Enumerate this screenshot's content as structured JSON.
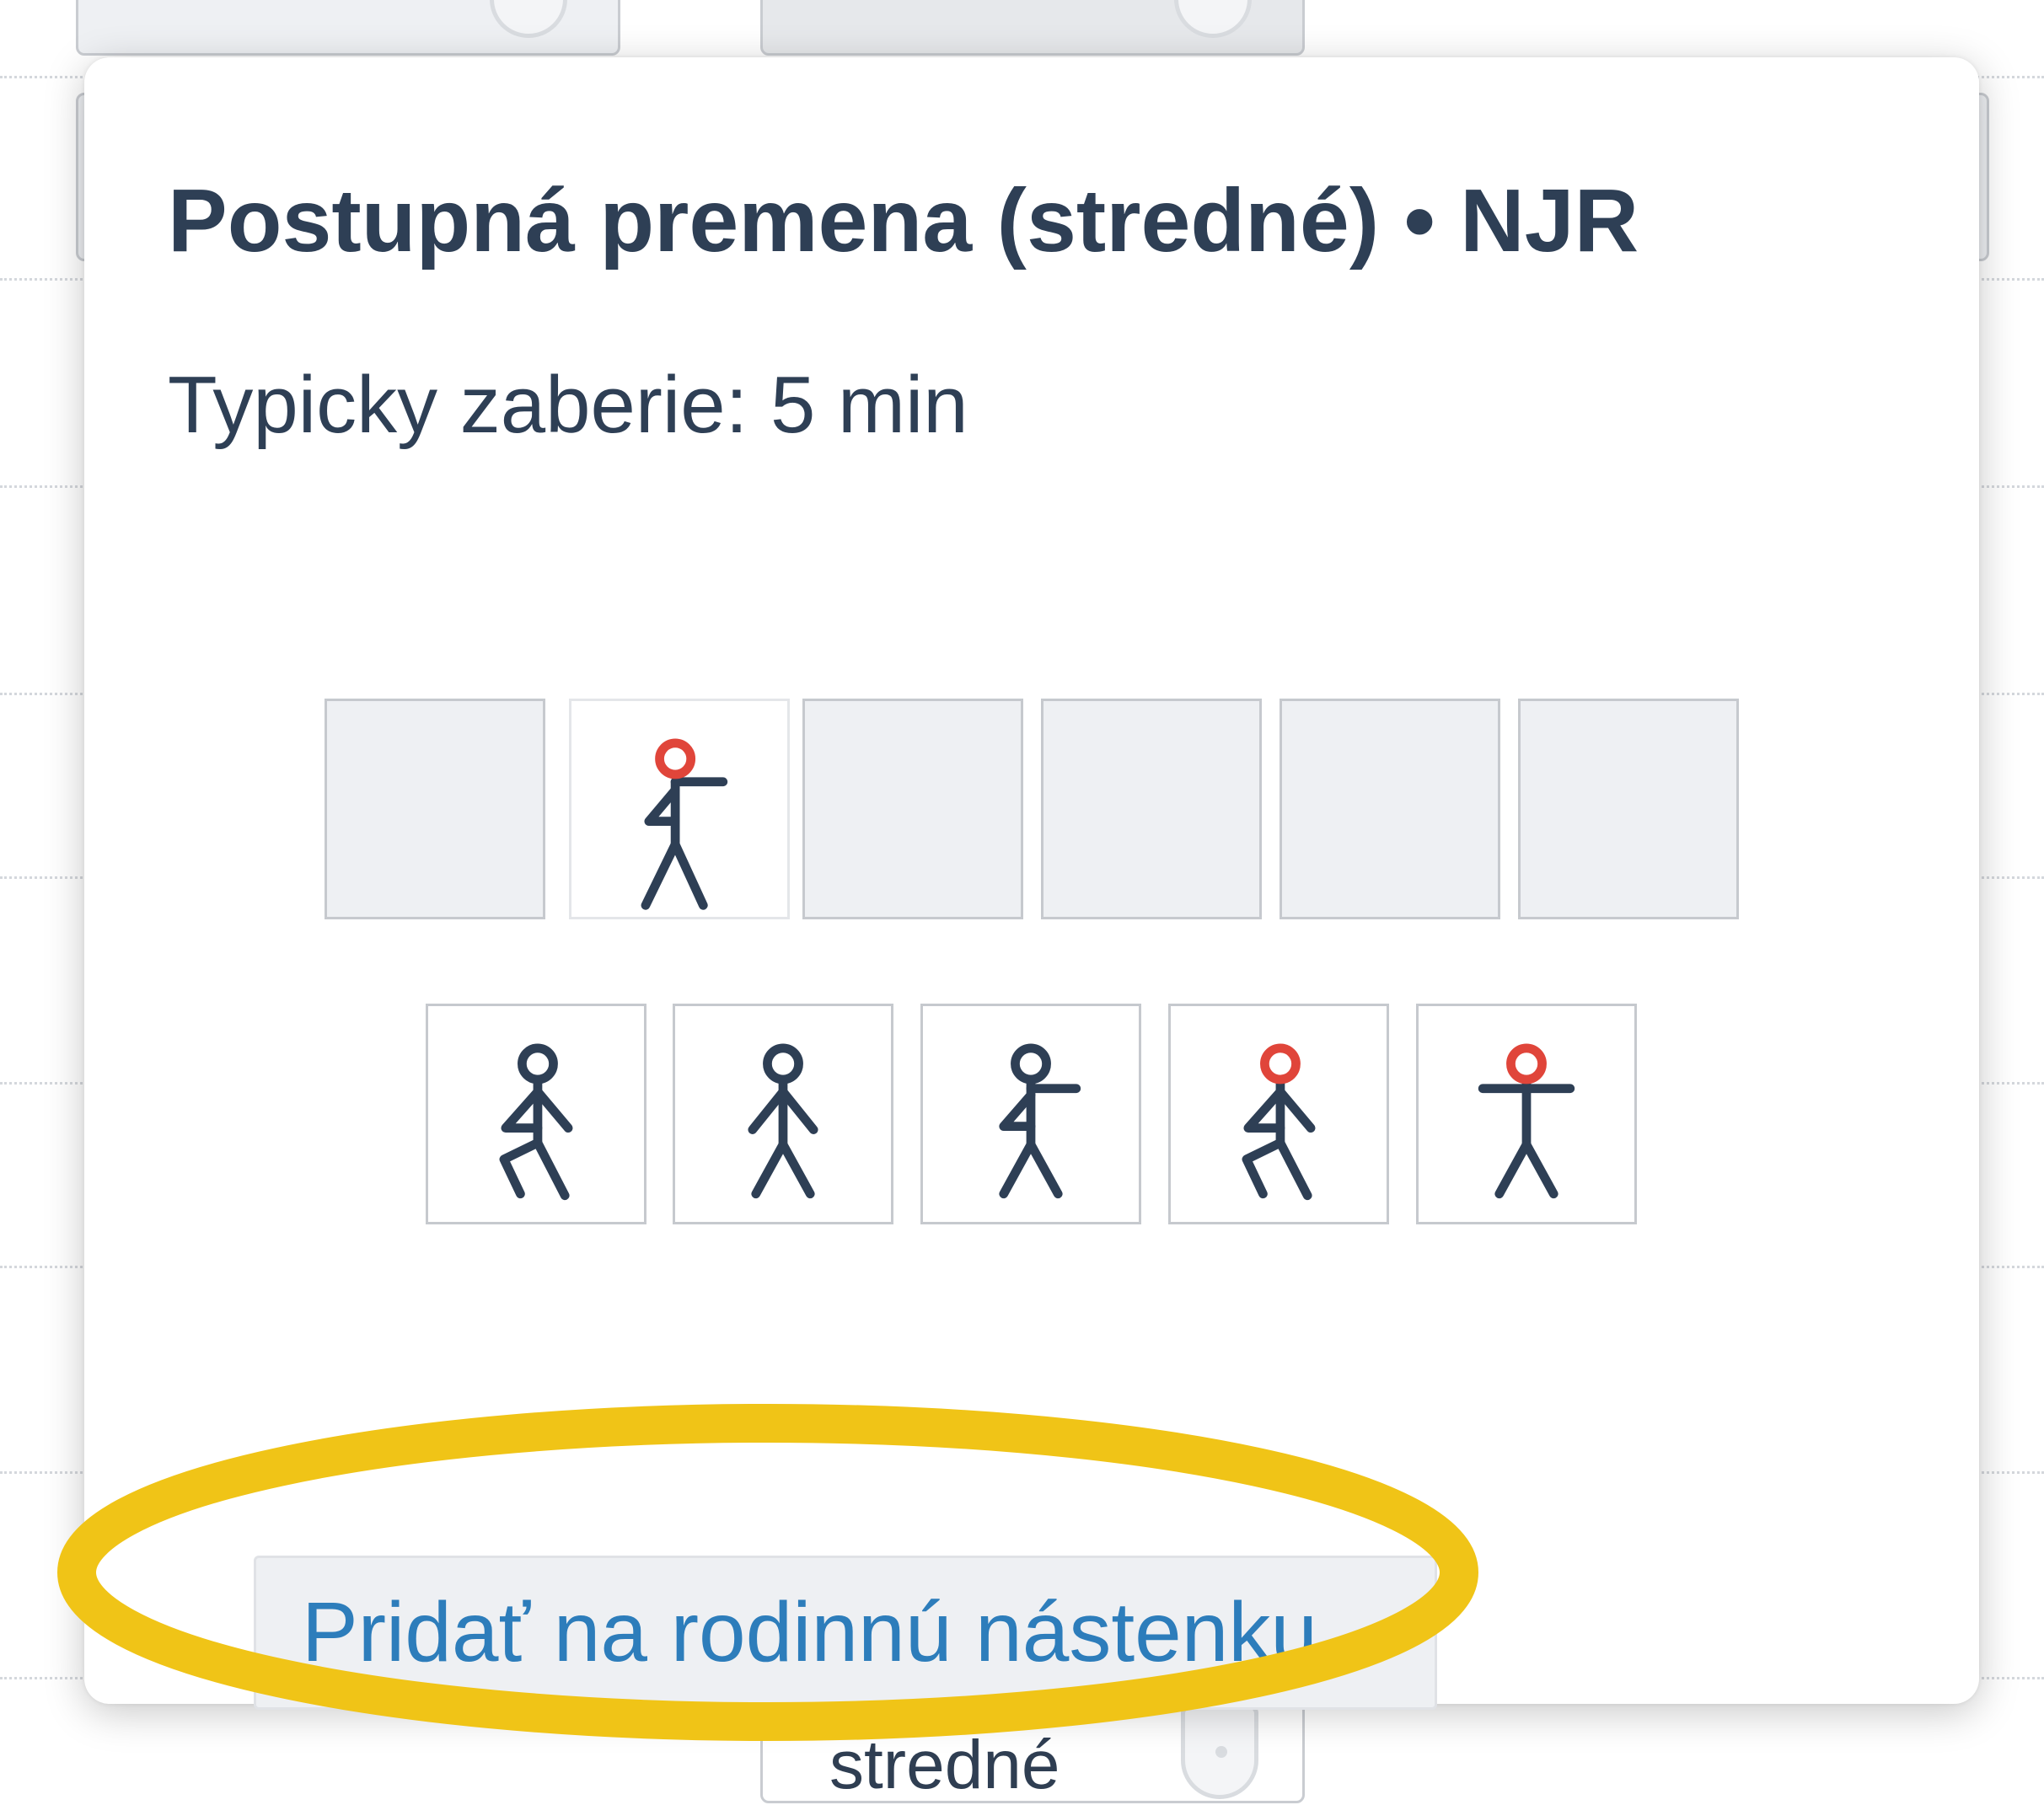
{
  "popup": {
    "title": "Postupná premena (stredné) • NJR",
    "duration": "Typicky zaberie: 5 min",
    "add_button_label": "Pridať na rodinnú nástenku"
  },
  "background": {
    "visible_label": "stredné"
  },
  "frames": {
    "sequence": [
      "empty",
      "arm-right-red",
      "empty",
      "empty",
      "empty",
      "empty"
    ],
    "choices": [
      "knee-kick",
      "walk",
      "arm-right",
      "knee-kick-red",
      "arms-out-red"
    ]
  },
  "colors": {
    "figure": "#2e3f55",
    "head_highlight": "#e0453a",
    "link": "#2d7dbb",
    "annotation": "#f0c417"
  }
}
